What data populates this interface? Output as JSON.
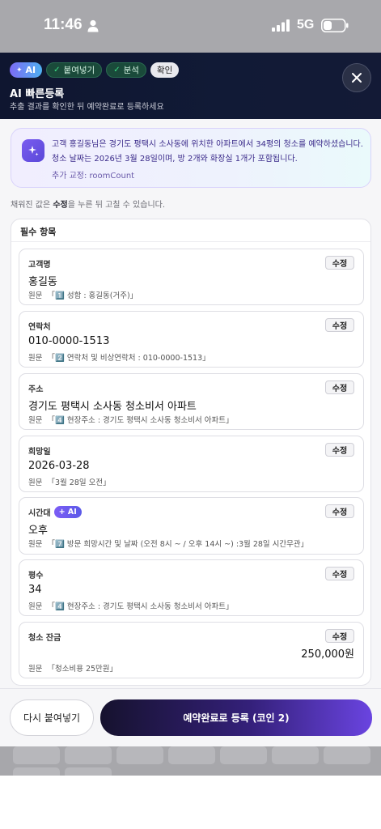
{
  "status_bar": {
    "time": "11:46",
    "network": "5G",
    "icons": [
      "person-icon",
      "signal-icon",
      "battery-icon"
    ]
  },
  "header": {
    "chips": {
      "ai": "AI",
      "step1": "붙여넣기",
      "step2": "분석",
      "current": "확인"
    },
    "title": "AI 빠른등록",
    "subtitle": "추출 결과를 확인한 뒤 예약완료로 등록하세요",
    "close_icon": "close-icon"
  },
  "summary": {
    "icon": "sparkle-icon",
    "text": "고객 홍길동님은 경기도 평택시 소사동에 위치한 아파트에서 34평의 청소를 예약하셨습니다. 청소 날짜는 2026년 3월 28일이며, 방 2개와 화장실 1개가 포함됩니다.",
    "extra": "추가 교정: roomCount"
  },
  "hint": {
    "before": "채워진 값은 ",
    "bold": "수정",
    "after": "을 누른 뒤 고칠 수 있습니다."
  },
  "section": {
    "title": "필수 항목",
    "edit_label": "수정",
    "source_label": "원문",
    "fields": [
      {
        "label": "고객명",
        "value": "홍길동",
        "source": "「1️⃣ 성함 : 홍길동(거주)」"
      },
      {
        "label": "연락처",
        "value": "010-0000-1513",
        "source": "「2️⃣ 연락처 및 비상연락처 : 010-0000-1513」"
      },
      {
        "label": "주소",
        "value": "경기도 평택시 소사동 청소비서 아파트",
        "source": "「4️⃣ 현장주소 : 경기도 평택시 소사동 청소비서 아파트」"
      },
      {
        "label": "희망일",
        "value": "2026-03-28",
        "source": "「3월 28일 오전」"
      },
      {
        "label": "시간대",
        "badge": "+ AI",
        "value": "오후",
        "source": "「7️⃣ 방문 희망시간 및 날짜 (오전 8시 ~ / 오후 14시 ~) :3월 28일 시간무관」"
      },
      {
        "label": "평수",
        "value": "34",
        "source": "「4️⃣ 현장주소 : 경기도 평택시 소사동 청소비서 아파트」"
      },
      {
        "label": "청소 잔금",
        "value": "250,000원",
        "source": "「청소비용 25만원」"
      }
    ]
  },
  "actions": {
    "repaste": "다시 붙여넣기",
    "submit": "예약완료로 등록 (코인 2)"
  },
  "colors": {
    "header_bg": "#0f1630",
    "accent_purple": "#6a44e0",
    "check_green": "#3ddc84"
  }
}
